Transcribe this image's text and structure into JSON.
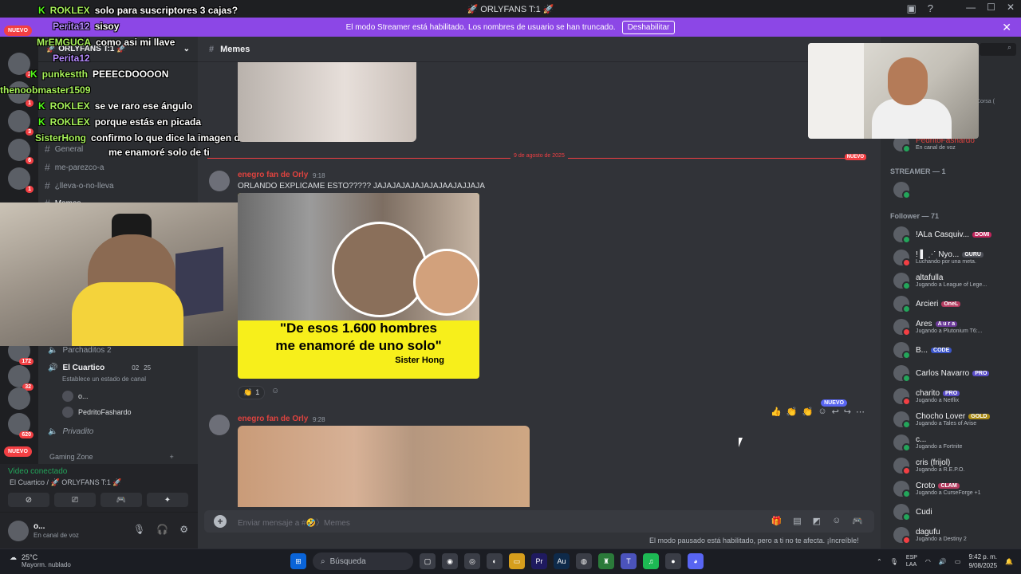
{
  "titlebar": {
    "title": "🚀 ORLYFANS T:1 🚀"
  },
  "banner": {
    "text": "El modo Streamer está habilitado. Los nombres de usuario se han truncado.",
    "button": "Deshabilitar"
  },
  "server_rail": {
    "nuevo_top": "NUEVO",
    "nuevo_bottom": "NUEVO",
    "badges": [
      "2",
      "1",
      "3",
      "6",
      "1",
      "172",
      "32",
      "620"
    ]
  },
  "channels": {
    "server_name": "🚀 ORLYFANS T:1 🚀",
    "items": [
      {
        "label": "General"
      },
      {
        "label": "me-parezco-a"
      },
      {
        "label": "¿lleva-o-no-lleva"
      },
      {
        "label": "Memes"
      },
      {
        "label": "Parchaditos 2"
      },
      {
        "label": "El Cuartico",
        "count1": "02",
        "count2": "25",
        "status": "Establece un estado de canal"
      },
      {
        "label": "Privadito"
      },
      {
        "label": "Gaming Zone"
      }
    ],
    "voice_users": [
      "o...",
      "PedritoFashardo"
    ]
  },
  "overlay_chat": [
    {
      "user": "ROKLEX",
      "msg": "solo para suscriptores 3 cajas?"
    },
    {
      "user": "Perita12",
      "msg": "sisoy"
    },
    {
      "user": "MrEMGUCA",
      "msg": "como asi mi llave"
    },
    {
      "user": "Perita12",
      "msg": ""
    },
    {
      "user": "punkestth",
      "msg": "PEEECDOOOON"
    },
    {
      "user": "thenoobmaster1509",
      "msg": ""
    },
    {
      "user": "ROKLEX",
      "msg": "se ve raro ese ángulo"
    },
    {
      "user": "ROKLEX",
      "msg": "porque estás en picada"
    },
    {
      "user": "SisterHong",
      "msg": "confirmo lo que dice la imagen de esos 1600"
    },
    {
      "user": "",
      "msg": "me enamoré solo de ti"
    }
  ],
  "voice_panel": {
    "status": "Video conectado",
    "location": "El Cuartico / 🚀 ORLYFANS T:1 🚀"
  },
  "user_panel": {
    "name": "o...",
    "status": "En canal de voz"
  },
  "main": {
    "channel_title": "Memes",
    "date_divider": "9 de agosto de 2025",
    "nuevo": "NUEVO",
    "messages": [
      {
        "author": "enegro fan de Orly",
        "time": "9:18",
        "text": "ORLANDO EXPLICAME ESTO????? JAJAJAJAJAJAJAJAAJAJJAJA"
      },
      {
        "author": "enegro fan de Orly",
        "time": "9:28",
        "text": ""
      }
    ],
    "meme_caption_1": "\"De esos 1.600 hombres",
    "meme_caption_2": "me enamoré de uno solo\"",
    "meme_caption_3": "Sister Hong",
    "reaction_count": "1",
    "composer_placeholder": "Enviar mensaje a #🤣〉Memes",
    "paused_text": "El modo pausado está habilitado, pero a ti no te afecta. ¡Increíble!"
  },
  "members": {
    "search_placeholder": "",
    "partial_top": "Corsa (",
    "top_user": "PedritoFashardo",
    "top_user_status": "En canal de voz",
    "streamer_heading": "STREAMER — 1",
    "follower_heading": "Follower — 71",
    "list": [
      {
        "name": "!ALa Casquiv...",
        "tag": "DOMI",
        "tag_color": "#c2255c",
        "activity": ""
      },
      {
        "name": "! ▌ ⋰ Nyo...",
        "tag": "GURU",
        "tag_color": "#4e5058",
        "activity": "Luchando por una meta."
      },
      {
        "name": "altafulla",
        "tag": "",
        "tag_color": "",
        "activity": "Jugando a League of Lege..."
      },
      {
        "name": "Arcieri",
        "tag": "OneL",
        "tag_color": "#b33a5e",
        "activity": ""
      },
      {
        "name": "Ares",
        "tag": "A u r a",
        "tag_color": "#6c3a99",
        "activity": "Jugando a Plutonium T6:..."
      },
      {
        "name": "B...",
        "tag": "CODE",
        "tag_color": "#3b55c9",
        "activity": ""
      },
      {
        "name": "Carlos Navarro",
        "tag": "PRO",
        "tag_color": "#5b4fc9",
        "activity": ""
      },
      {
        "name": "charito",
        "tag": "PRO",
        "tag_color": "#5b4fc9",
        "activity": "Jugando a Netflix"
      },
      {
        "name": "Chocho Lover",
        "tag": "GOLD",
        "tag_color": "#a98b18",
        "activity": "Jugando a Tales of Arise"
      },
      {
        "name": "c...",
        "tag": "",
        "tag_color": "",
        "activity": "Jugando a Fortnite"
      },
      {
        "name": "cris (frijol)",
        "tag": "",
        "tag_color": "",
        "activity": "Jugando a R.E.P.O."
      },
      {
        "name": "Croto",
        "tag": "CLAM",
        "tag_color": "#b33a5e",
        "activity": "Jugando a CurseForge +1"
      },
      {
        "name": "Cudi",
        "tag": "",
        "tag_color": "",
        "activity": ""
      },
      {
        "name": "dagufu",
        "tag": "",
        "tag_color": "",
        "activity": "Jugando a Destiny 2"
      }
    ]
  },
  "taskbar": {
    "temp": "25°C",
    "weather": "Mayorm. nublado",
    "search": "Búsqueda",
    "lang1": "ESP",
    "lang2": "LAA",
    "time": "9:42 p. m.",
    "date": "9/08/2025"
  }
}
